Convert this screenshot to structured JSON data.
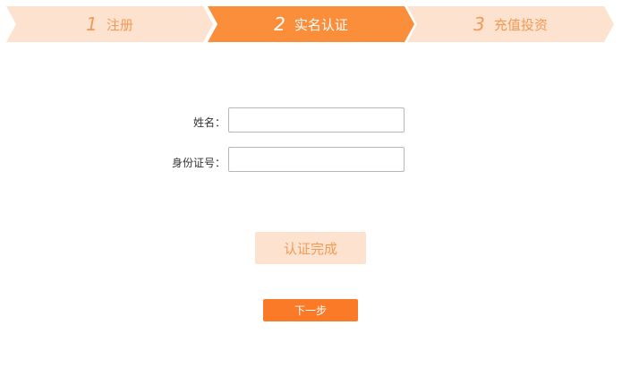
{
  "steps": [
    {
      "number": "1",
      "label": "注册",
      "state": "inactive"
    },
    {
      "number": "2",
      "label": "实名认证",
      "state": "active"
    },
    {
      "number": "3",
      "label": "充值投资",
      "state": "inactive"
    }
  ],
  "form": {
    "name_label": "姓名：",
    "name_value": "",
    "id_label": "身份证号：",
    "id_value": ""
  },
  "buttons": {
    "confirm_label": "认证完成",
    "next_label": "下一步"
  },
  "colors": {
    "step_active": "#fb8e3b",
    "step_inactive": "#fde3cf",
    "next_button": "#fb7a27"
  }
}
